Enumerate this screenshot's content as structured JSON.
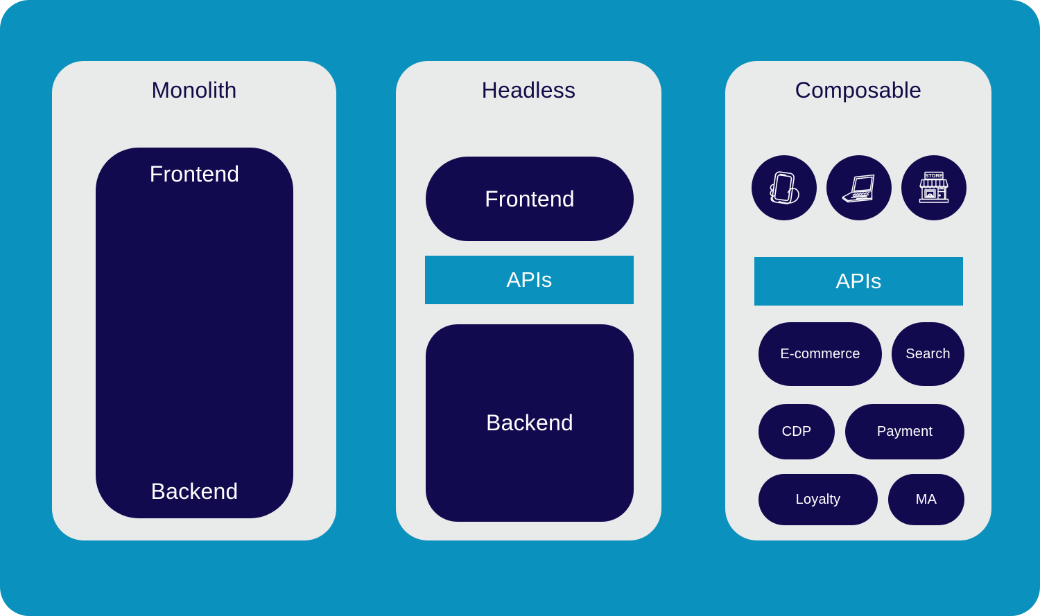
{
  "canvas": {
    "background_color": "#0b91bd",
    "card_background_color": "#e9eaea",
    "node_color": "#120a4f",
    "accent_color": "#0b91bd",
    "text_on_dark": "#ffffff",
    "title_color": "#120a47"
  },
  "columns": {
    "monolith": {
      "title": "Monolith",
      "block": {
        "frontend_label": "Frontend",
        "backend_label": "Backend"
      }
    },
    "headless": {
      "title": "Headless",
      "frontend_label": "Frontend",
      "apis_label": "APIs",
      "backend_label": "Backend"
    },
    "composable": {
      "title": "Composable",
      "channels": [
        {
          "icon": "mobile-phone-in-hand-icon",
          "name": "mobile"
        },
        {
          "icon": "laptop-icon",
          "name": "laptop"
        },
        {
          "icon": "storefront-icon",
          "name": "store",
          "sign_text": "STORE"
        }
      ],
      "apis_label": "APIs",
      "services": [
        {
          "label": "E-commerce"
        },
        {
          "label": "Search"
        },
        {
          "label": "CDP"
        },
        {
          "label": "Payment"
        },
        {
          "label": "Loyalty"
        },
        {
          "label": "MA"
        }
      ]
    }
  }
}
